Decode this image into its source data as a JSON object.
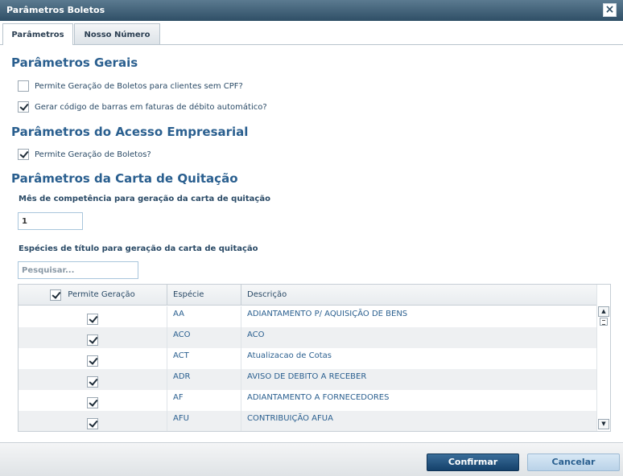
{
  "window": {
    "title": "Parâmetros Boletos",
    "close_glyph": "×"
  },
  "tabs": [
    {
      "label": "Parâmetros",
      "active": true
    },
    {
      "label": "Nosso Número",
      "active": false
    }
  ],
  "sections": {
    "gerais": {
      "title": "Parâmetros Gerais",
      "options": [
        {
          "label": "Permite Geração de Boletos para clientes sem CPF?",
          "checked": false
        },
        {
          "label": "Gerar código de barras em faturas de débito automático?",
          "checked": true
        }
      ]
    },
    "acesso": {
      "title": "Parâmetros do Acesso Empresarial",
      "options": [
        {
          "label": "Permite Geração de Boletos?",
          "checked": true
        }
      ]
    },
    "carta": {
      "title": "Parâmetros da Carta de Quitação",
      "mes_label": "Mês de competência para geração da carta de quitação",
      "mes_value": "1",
      "especies_label": "Espécies de título para geração da carta de quitação",
      "search_placeholder": "Pesquisar..."
    }
  },
  "grid": {
    "headers": {
      "permite": "Permite Geração",
      "especie": "Espécie",
      "descricao": "Descrição"
    },
    "header_checked": true,
    "rows": [
      {
        "especie": "AA",
        "descricao": "ADIANTAMENTO P/ AQUISIÇÃO DE BENS",
        "checked": true
      },
      {
        "especie": "ACO",
        "descricao": "ACO",
        "checked": true
      },
      {
        "especie": "ACT",
        "descricao": "Atualizacao de Cotas",
        "checked": true
      },
      {
        "especie": "ADR",
        "descricao": "AVISO DE DEBITO A RECEBER",
        "checked": true
      },
      {
        "especie": "AF",
        "descricao": "ADIANTAMENTO A FORNECEDORES",
        "checked": true
      },
      {
        "especie": "AFU",
        "descricao": "CONTRIBUIÇÃO AFUA",
        "checked": true
      }
    ]
  },
  "footer": {
    "confirm_label": "Confirmar",
    "cancel_label": "Cancelar"
  },
  "colors": {
    "accent": "#2a5f8f",
    "titlebar": "#2f4f66",
    "confirm": "#14406a",
    "cancel": "#b9d2e8"
  }
}
